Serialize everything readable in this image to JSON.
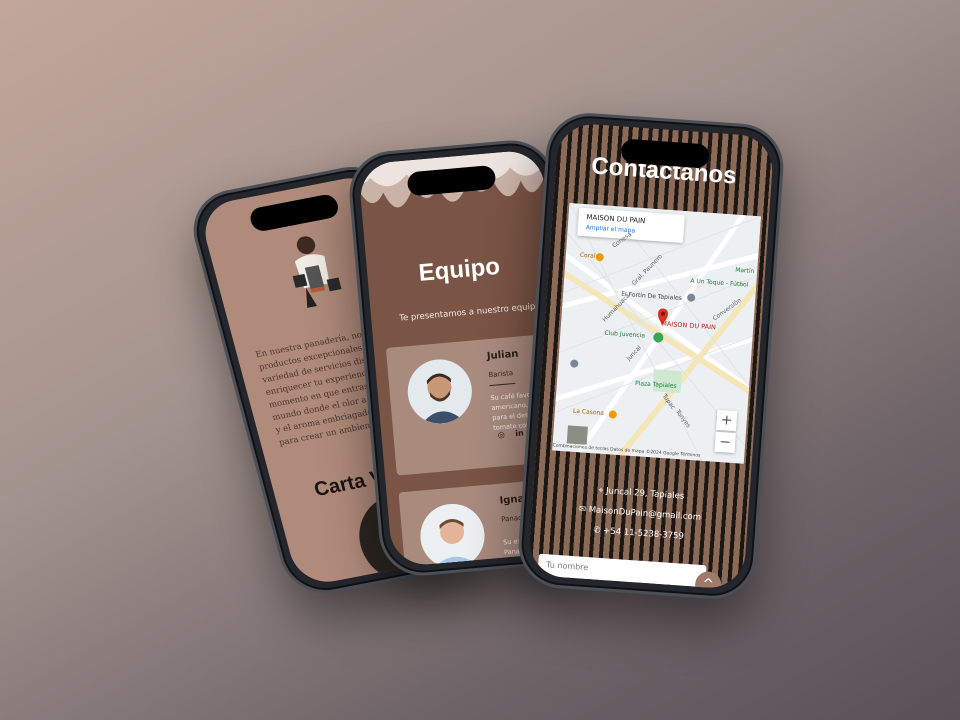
{
  "phone_about": {
    "paragraph": "En nuestra panadería, no solo ofrecemos productos excepcionales, sino también una variedad de servicios diseñados para enriquecer tu experiencia. Desde el momento en que entras, te sumerges en un mundo donde el olor a fermentación natural y el aroma embriagador del café se fusionan para crear un ambiente único.",
    "menu_title": "Carta Virtual"
  },
  "phone_team": {
    "title": "Equipo",
    "subtitle": "Te presentamos a nuestro equipo",
    "members": [
      {
        "name": "Julian",
        "role": "Barista",
        "desc": "Su café favorito es el americano, lo pide siempre para el desayuno con un tomate cortado..."
      },
      {
        "name": "Ignacio",
        "role": "Panadero",
        "desc": "Su especialidad... Dorado... Panadero..."
      }
    ]
  },
  "phone_contact": {
    "title": "Contáctanos",
    "map": {
      "place_title": "MAISON DU PAIN",
      "place_link": "Ampliar el mapa",
      "pin_label": "MAISON DU PAIN",
      "labels": [
        "Coral",
        "A Un Toque - Fútbol",
        "El Fortín De Tapiales",
        "Club Juvencia",
        "Plaza Tapiales",
        "La Casona",
        "Conesa",
        "Gral. Paunero",
        "Humahuaca",
        "Juncal",
        "Tupac",
        "Tonyes",
        "Conversión",
        "Martín"
      ],
      "footer": "Combinaciones de teclas   Datos de mapa ©2024 Google   Términos",
      "zoom_in": "+",
      "zoom_out": "−"
    },
    "address": "Juncal 29, Tapiales",
    "email": "MaisonDuPain@gmail.com",
    "phone": "+54 11-5238-3759",
    "name_placeholder": "Tu nombre",
    "scroll_top": "^"
  }
}
